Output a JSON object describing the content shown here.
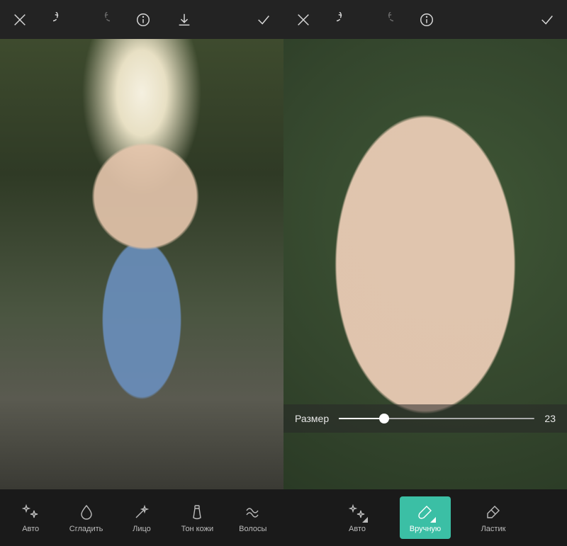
{
  "left": {
    "topbar": {
      "close": "close",
      "undo": "undo",
      "redo": "redo",
      "info": "info",
      "download": "download",
      "confirm": "confirm"
    },
    "tools": [
      {
        "key": "auto",
        "label": "Авто",
        "icon": "sparkle"
      },
      {
        "key": "smooth",
        "label": "Сгладить",
        "icon": "drop"
      },
      {
        "key": "face",
        "label": "Лицо",
        "icon": "wand"
      },
      {
        "key": "tone",
        "label": "Тон кожи",
        "icon": "tube"
      },
      {
        "key": "hair",
        "label": "Волосы",
        "icon": "wave"
      }
    ]
  },
  "right": {
    "topbar": {
      "close": "close",
      "undo": "undo",
      "redo": "redo",
      "info": "info",
      "confirm": "confirm"
    },
    "slider": {
      "label": "Размер",
      "value": 23,
      "min": 0,
      "max": 100
    },
    "tools": [
      {
        "key": "auto",
        "label": "Авто",
        "icon": "sparkle",
        "active": false
      },
      {
        "key": "manual",
        "label": "Вручную",
        "icon": "brush",
        "active": true
      },
      {
        "key": "eraser",
        "label": "Ластик",
        "icon": "eraser",
        "active": false
      }
    ]
  },
  "colors": {
    "accent": "#3bbfa5",
    "bar": "#232323",
    "panel": "#1a1a1a"
  }
}
